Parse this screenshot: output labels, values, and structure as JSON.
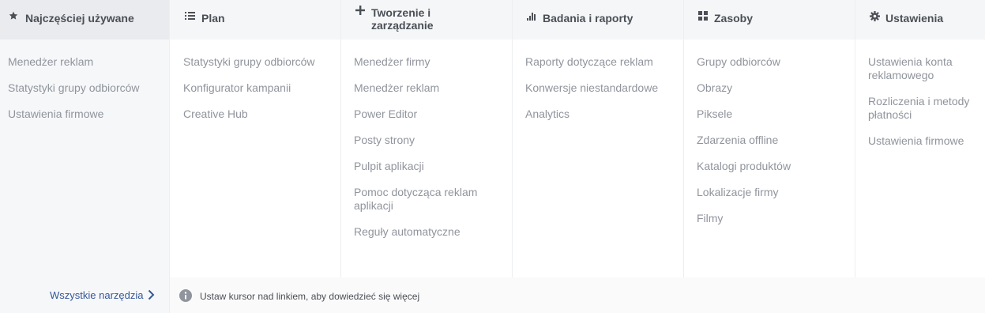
{
  "columns": [
    {
      "title": "Najczęściej używane",
      "icon": "star-icon",
      "items": [
        "Menedżer reklam",
        "Statystyki grupy odbiorców",
        "Ustawienia firmowe"
      ]
    },
    {
      "title": "Plan",
      "icon": "list-icon",
      "items": [
        "Statystyki grupy odbiorców",
        "Konfigurator kampanii",
        "Creative Hub"
      ]
    },
    {
      "title": "Tworzenie i zarządzanie",
      "icon": "plus-icon",
      "items": [
        "Menedżer firmy",
        "Menedżer reklam",
        "Power Editor",
        "Posty strony",
        "Pulpit aplikacji",
        "Pomoc dotycząca reklam aplikacji",
        "Reguły automatyczne"
      ]
    },
    {
      "title": "Badania i raporty",
      "icon": "bar-chart-icon",
      "items": [
        "Raporty dotyczące reklam",
        "Konwersje niestandardowe",
        "Analytics"
      ]
    },
    {
      "title": "Zasoby",
      "icon": "grid-icon",
      "items": [
        "Grupy odbiorców",
        "Obrazy",
        "Piksele",
        "Zdarzenia offline",
        "Katalogi produktów",
        "Lokalizacje firmy",
        "Filmy"
      ]
    },
    {
      "title": "Ustawienia",
      "icon": "gear-icon",
      "items": [
        "Ustawienia konta reklamowego",
        "Rozliczenia i metody płatności",
        "Ustawienia firmowe"
      ]
    }
  ],
  "footer": {
    "all_tools_label": "Wszystkie narzędzia",
    "hint": "Ustaw kursor nad linkiem, aby dowiedzieć się więcej",
    "info_icon": "info-icon",
    "chevron_icon": "chevron-right-icon"
  },
  "colors": {
    "link": "#365899",
    "item_text": "#90949c",
    "header_text": "#4b4f56"
  }
}
